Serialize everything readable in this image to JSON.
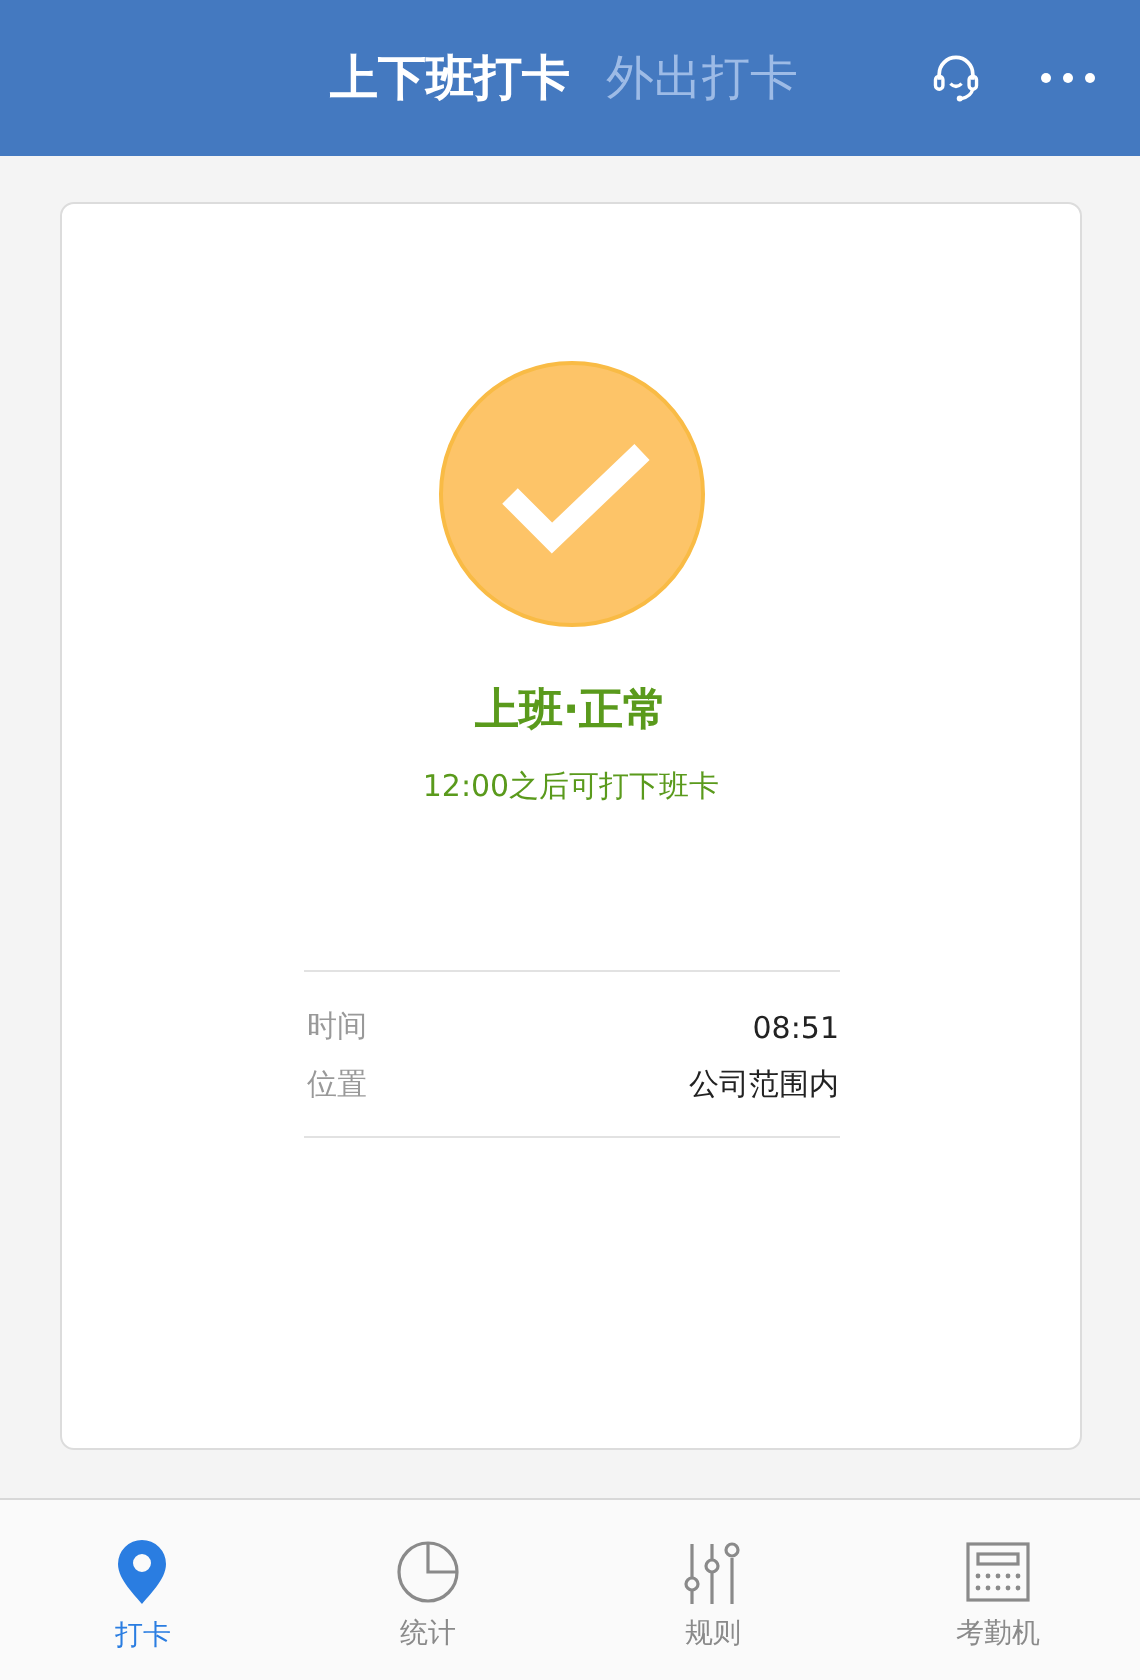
{
  "header": {
    "tabs": [
      {
        "label": "上下班打卡",
        "selected": true
      },
      {
        "label": "外出打卡",
        "selected": false
      }
    ]
  },
  "status": {
    "checked": true,
    "title": "上班·正常",
    "subtitle": "12:00之后可打下班卡"
  },
  "details": [
    {
      "label": "时间",
      "value": "08:51"
    },
    {
      "label": "位置",
      "value": "公司范围内"
    }
  ],
  "nav": [
    {
      "kind": "pin",
      "label": "打卡",
      "selected": true
    },
    {
      "kind": "pie",
      "label": "统计",
      "selected": false
    },
    {
      "kind": "sliders",
      "label": "规则",
      "selected": false
    },
    {
      "kind": "machine",
      "label": "考勤机",
      "selected": false
    }
  ]
}
